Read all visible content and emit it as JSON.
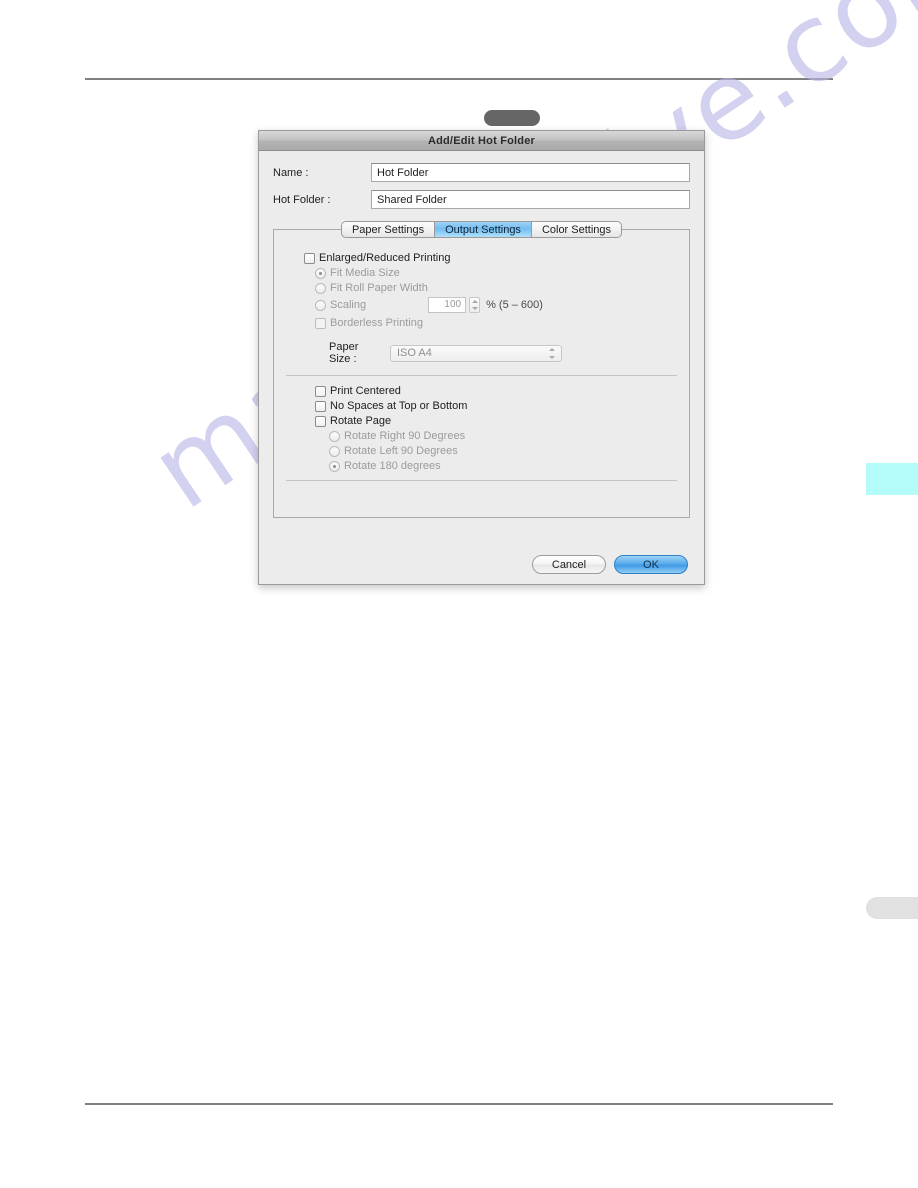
{
  "page": {
    "watermark": "manualshive.com"
  },
  "dialog": {
    "title": "Add/Edit Hot Folder",
    "fields": [
      {
        "label": "Name :",
        "value": "Hot Folder"
      },
      {
        "label": "Hot Folder :",
        "value": "Shared Folder"
      }
    ],
    "tabs": [
      {
        "label": "Paper Settings",
        "selected": false
      },
      {
        "label": "Output Settings",
        "selected": true
      },
      {
        "label": "Color Settings",
        "selected": false
      }
    ],
    "output_settings": {
      "enlarged_reduced": {
        "label": "Enlarged/Reduced Printing",
        "checked": false,
        "options": [
          {
            "label": "Fit Media Size",
            "selected": true
          },
          {
            "label": "Fit Roll Paper Width",
            "selected": false
          },
          {
            "label": "Scaling",
            "selected": false
          }
        ],
        "scaling": {
          "value": "100",
          "suffix": "% (5 – 600)"
        },
        "borderless": {
          "label": "Borderless Printing",
          "checked": false
        }
      },
      "paper_size": {
        "label": "Paper Size :",
        "value": "ISO A4"
      },
      "checkboxes": [
        {
          "label": "Print Centered",
          "checked": false
        },
        {
          "label": "No Spaces at Top or Bottom",
          "checked": false
        },
        {
          "label": "Rotate Page",
          "checked": false
        }
      ],
      "rotate_options": [
        {
          "label": "Rotate Right 90 Degrees",
          "selected": false
        },
        {
          "label": "Rotate Left 90 Degrees",
          "selected": false
        },
        {
          "label": "Rotate 180 degrees",
          "selected": true
        }
      ]
    },
    "buttons": {
      "cancel": "Cancel",
      "ok": "OK"
    }
  },
  "colors": {
    "selected_tab": "#74bdf0",
    "default_button": "#3e9ae6",
    "edge_marker_cyan": "#b3fcfa",
    "edge_marker_gray": "#e1e1e1",
    "watermark": "#b9b6e8"
  }
}
